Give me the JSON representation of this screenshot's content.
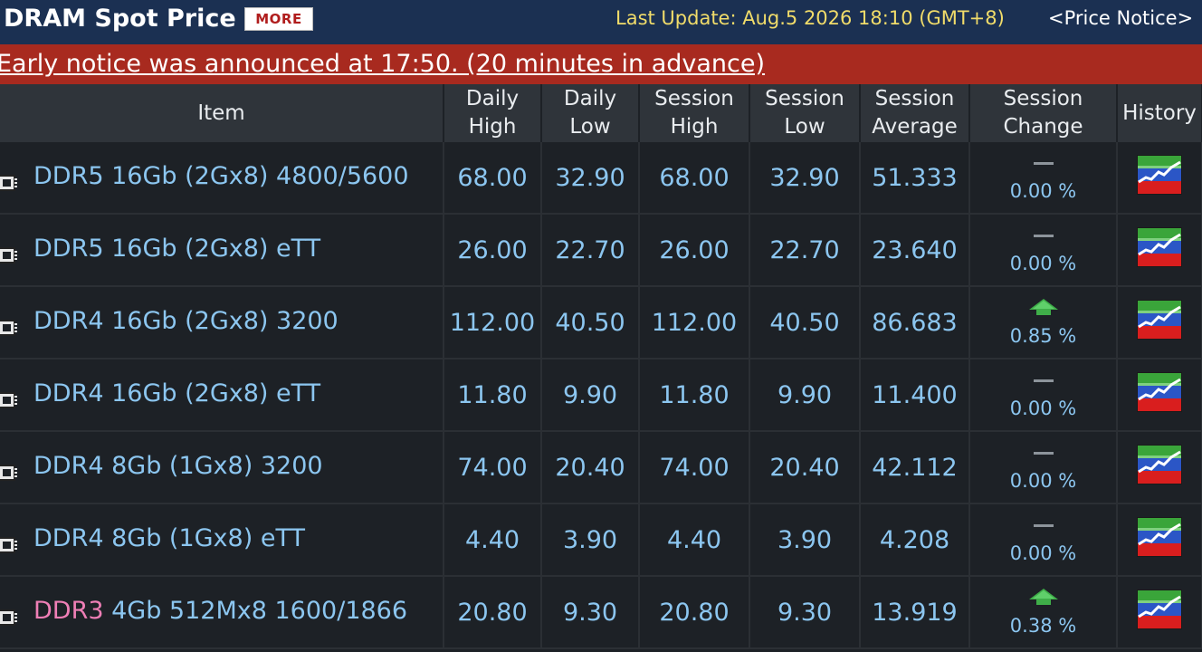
{
  "header": {
    "title": "DRAM Spot Price",
    "more_label": "MORE",
    "last_update": "Last Update: Aug.5 2026 18:10 (GMT+8)",
    "price_notice": "<Price Notice>"
  },
  "notice": {
    "text": "Early notice was announced at 17:50. (20 minutes in advance)"
  },
  "table": {
    "columns": [
      [
        "Item"
      ],
      [
        "Daily",
        "High"
      ],
      [
        "Daily",
        "Low"
      ],
      [
        "Session",
        "High"
      ],
      [
        "Session",
        "Low"
      ],
      [
        "Session",
        "Average"
      ],
      [
        "Session",
        "Change"
      ],
      [
        "History"
      ]
    ],
    "rows": [
      {
        "prefix": "",
        "item": "DDR5 16Gb (2Gx8) 4800/5600",
        "daily_high": "68.00",
        "daily_low": "32.90",
        "session_high": "68.00",
        "session_low": "32.90",
        "session_avg": "51.333",
        "change_dir": "flat",
        "change": "0.00 %"
      },
      {
        "prefix": "",
        "item": "DDR5 16Gb (2Gx8) eTT",
        "daily_high": "26.00",
        "daily_low": "22.70",
        "session_high": "26.00",
        "session_low": "22.70",
        "session_avg": "23.640",
        "change_dir": "flat",
        "change": "0.00 %"
      },
      {
        "prefix": "",
        "item": "DDR4 16Gb (2Gx8) 3200",
        "daily_high": "112.00",
        "daily_low": "40.50",
        "session_high": "112.00",
        "session_low": "40.50",
        "session_avg": "86.683",
        "change_dir": "up",
        "change": "0.85 %"
      },
      {
        "prefix": "",
        "item": "DDR4 16Gb (2Gx8) eTT",
        "daily_high": "11.80",
        "daily_low": "9.90",
        "session_high": "11.80",
        "session_low": "9.90",
        "session_avg": "11.400",
        "change_dir": "flat",
        "change": "0.00 %"
      },
      {
        "prefix": "",
        "item": "DDR4 8Gb (1Gx8) 3200",
        "daily_high": "74.00",
        "daily_low": "20.40",
        "session_high": "74.00",
        "session_low": "20.40",
        "session_avg": "42.112",
        "change_dir": "flat",
        "change": "0.00 %"
      },
      {
        "prefix": "",
        "item": "DDR4 8Gb (1Gx8) eTT",
        "daily_high": "4.40",
        "daily_low": "3.90",
        "session_high": "4.40",
        "session_low": "3.90",
        "session_avg": "4.208",
        "change_dir": "flat",
        "change": "0.00 %"
      },
      {
        "prefix": "DDR3",
        "item": " 4Gb 512Mx8 1600/1866",
        "daily_high": "20.80",
        "daily_low": "9.30",
        "session_high": "20.80",
        "session_low": "9.30",
        "session_avg": "13.919",
        "change_dir": "up",
        "change": "0.38 %"
      }
    ]
  },
  "icons": {
    "row_icon": "chip-icon",
    "flat": "flat-dash-icon",
    "up": "up-arrow-icon",
    "history": "history-chart-icon"
  },
  "colors": {
    "header_bg": "#1b3052",
    "notice_bg": "#a82a1f",
    "value_text": "#8cc6f0",
    "update_text": "#f1dc6a",
    "ddr3_prefix": "#ef7fb6",
    "up_arrow": "#3fae49"
  }
}
